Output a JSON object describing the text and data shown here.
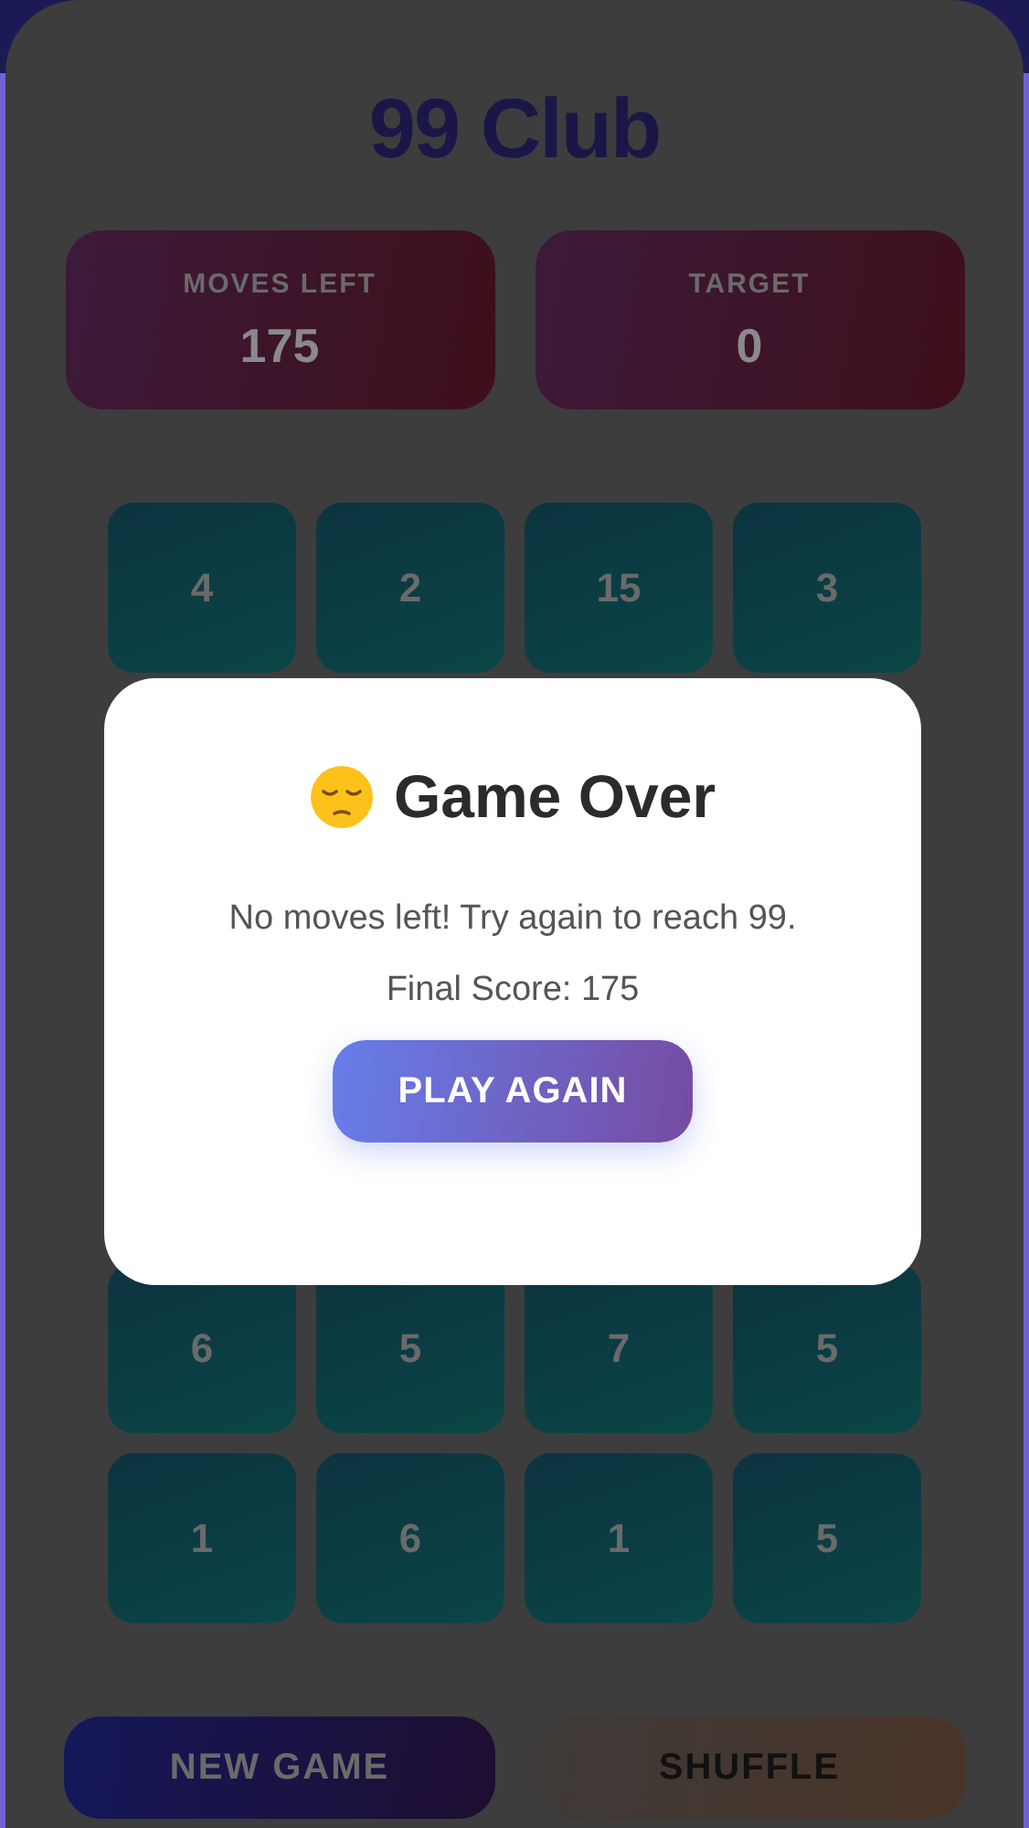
{
  "title": "99 Club",
  "stats": [
    {
      "label": "MOVES LEFT",
      "value": "175"
    },
    {
      "label": "TARGET",
      "value": "0"
    }
  ],
  "tile_rows": [
    [
      "4",
      "2",
      "15",
      "3"
    ],
    [
      "6",
      "5",
      "7",
      "5"
    ],
    [
      "1",
      "6",
      "1",
      "5"
    ]
  ],
  "buttons": [
    {
      "label": "NEW GAME",
      "kind": "primary"
    },
    {
      "label": "SHUFFLE",
      "kind": "secondary"
    }
  ],
  "dialog": {
    "title": "Game Over",
    "message": "No moves left! Try again to reach 99.",
    "score": "Final Score: 175",
    "button": "PLAY AGAIN"
  }
}
